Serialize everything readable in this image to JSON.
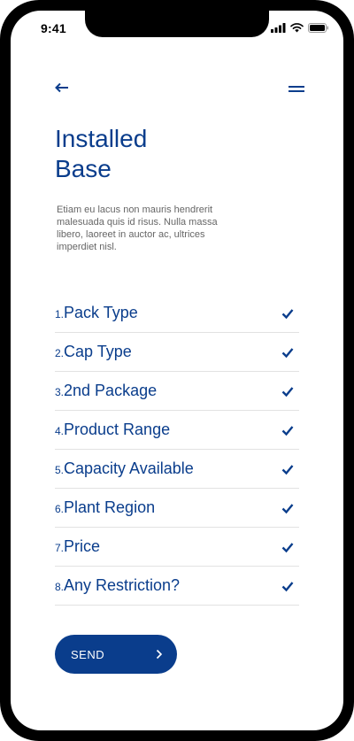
{
  "status_bar": {
    "time": "9:41",
    "icons": [
      "signal-icon",
      "wifi-icon",
      "battery-icon"
    ]
  },
  "header": {
    "back_icon": "arrow-left-icon",
    "menu_icon": "menu-icon"
  },
  "title": {
    "line1": "Installed",
    "line2": "Base"
  },
  "description": "Etiam eu lacus non mauris hendrerit malesuada quis id risus. Nulla massa libero, laoreet in auctor ac, ultrices imperdiet nisl.",
  "checklist": [
    {
      "num": "1.",
      "label": "Pack Type",
      "checked": true
    },
    {
      "num": "2.",
      "label": "Cap Type",
      "checked": true
    },
    {
      "num": "3.",
      "label": "2nd Package",
      "checked": true
    },
    {
      "num": "4.",
      "label": "Product Range",
      "checked": true
    },
    {
      "num": "5.",
      "label": "Capacity Available",
      "checked": true
    },
    {
      "num": "6.",
      "label": "Plant Region",
      "checked": true
    },
    {
      "num": "7.",
      "label": "Price",
      "checked": true
    },
    {
      "num": "8.",
      "label": "Any Restriction?",
      "checked": true
    }
  ],
  "send_button": {
    "label": "SEND",
    "icon": "chevron-right-icon"
  },
  "colors": {
    "primary": "#0a3d8c",
    "text_muted": "#666666",
    "divider": "#e2e2e2"
  }
}
